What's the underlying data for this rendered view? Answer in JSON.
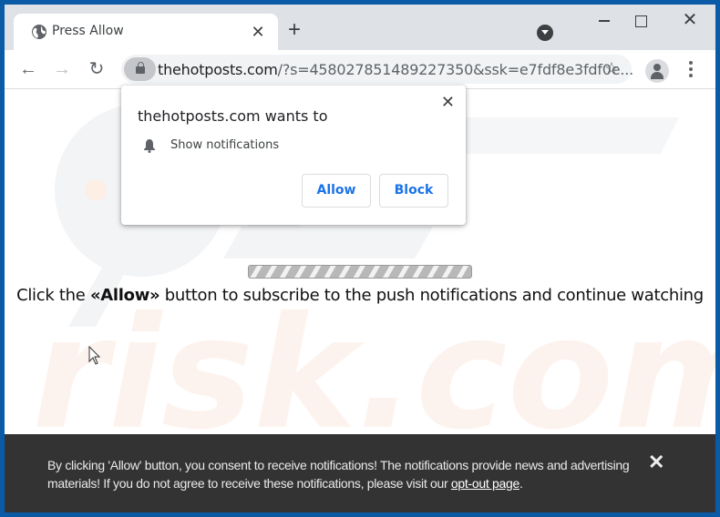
{
  "browser": {
    "tab": {
      "title": "Press Allow",
      "icon": "globe-icon",
      "close_glyph": "✕"
    },
    "new_tab_glyph": "+",
    "window_controls": {
      "minimize": "minimize-icon",
      "maximize": "maximize-icon",
      "close_glyph": "✕"
    },
    "nav": {
      "back_glyph": "←",
      "forward_glyph": "→",
      "reload_glyph": "↻"
    },
    "address_bar": {
      "domain": "thehotposts.com",
      "path": "/?s=458027851489227350&ssk=e7fdf8e3fdf0e...",
      "star_glyph": "☆"
    }
  },
  "permission_popup": {
    "title": "thehotposts.com wants to",
    "permission": "Show notifications",
    "allow_label": "Allow",
    "block_label": "Block",
    "close_glyph": "✕",
    "accent_color": "#1a73e8"
  },
  "page": {
    "progress_percent": 100,
    "message_before": "Click the ",
    "message_bold": "«Allow»",
    "message_after": " button to subscribe to the push notifications and continue watching",
    "watermark_text": "risk.com"
  },
  "banner": {
    "text": "By clicking 'Allow' button, you consent to receive notifications! The notifications provide news and advertising materials! If you do not agree to receive these notifications, please visit our ",
    "link_text": "opt-out page",
    "text_end": ".",
    "close_glyph": "✕",
    "background_color": "#333333"
  }
}
